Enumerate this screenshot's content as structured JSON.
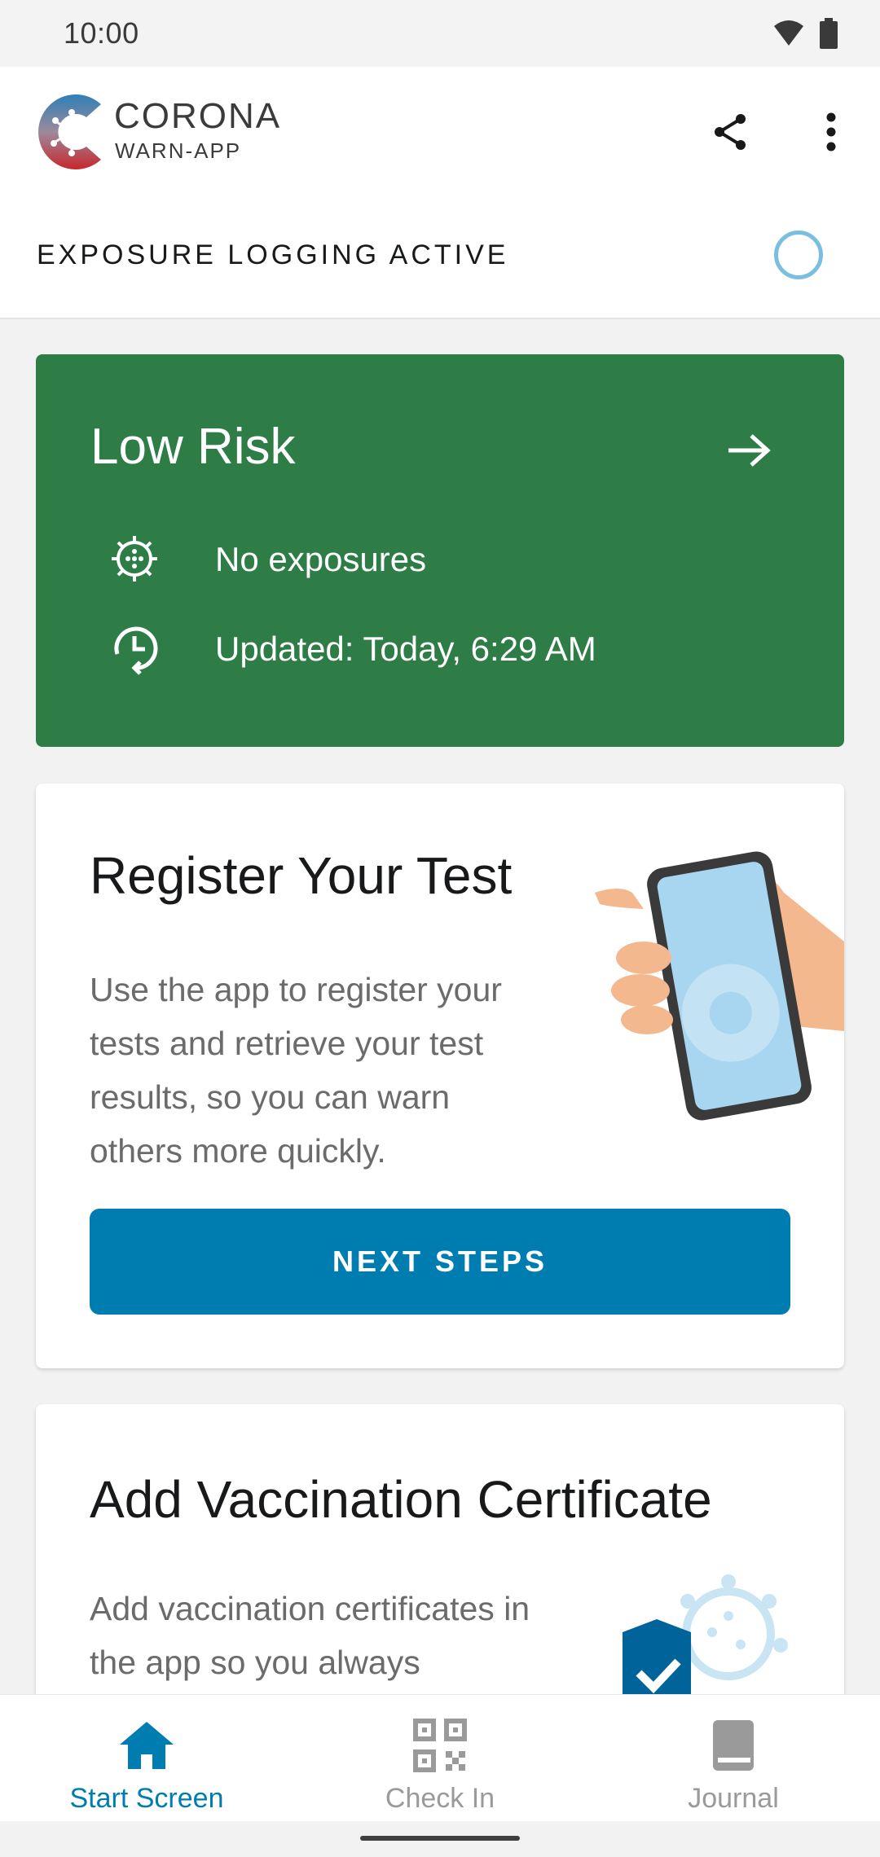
{
  "status_bar": {
    "time": "10:00"
  },
  "header": {
    "logo_line1": "CORONA",
    "logo_line2": "WARN-APP",
    "exposure_status": "EXPOSURE LOGGING ACTIVE"
  },
  "risk_card": {
    "title": "Low Risk",
    "exposures": "No exposures",
    "updated": "Updated: Today, 6:29 AM",
    "color": "#2e7d46"
  },
  "test_card": {
    "title": "Register Your Test",
    "body": "Use the app to register your tests and retrieve your test results, so you can warn others more quickly.",
    "button_label": "NEXT STEPS"
  },
  "vaccination_card": {
    "title": "Add Vaccination Certificate",
    "body": "Add vaccination certificates in the app so you always"
  },
  "bottom_nav": {
    "items": [
      {
        "label": "Start Screen",
        "icon": "home-icon",
        "active": true
      },
      {
        "label": "Check In",
        "icon": "qr-code-icon",
        "active": false
      },
      {
        "label": "Journal",
        "icon": "book-icon",
        "active": false
      }
    ]
  },
  "colors": {
    "accent": "#007db0",
    "risk_low": "#2e7d46",
    "ring": "#7bbfe0"
  }
}
